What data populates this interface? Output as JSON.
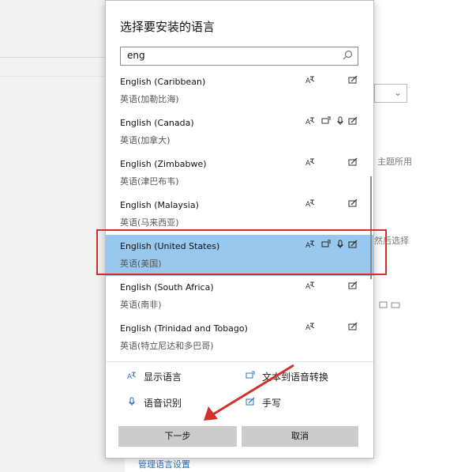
{
  "background": {
    "text_theme": "主题所用",
    "text_select": "然后选择",
    "link_manage": "管理语言设置"
  },
  "dialog": {
    "title": "选择要安装的语言",
    "search_value": "eng",
    "languages": [
      {
        "name": "English (Caribbean)",
        "native": "英语(加勒比海)",
        "features": [
          "text",
          "handwriting"
        ]
      },
      {
        "name": "English (Canada)",
        "native": "英语(加拿大)",
        "features": [
          "text",
          "speech",
          "mic",
          "handwriting"
        ]
      },
      {
        "name": "English (Zimbabwe)",
        "native": "英语(津巴布韦)",
        "features": [
          "text",
          "handwriting"
        ]
      },
      {
        "name": "English (Malaysia)",
        "native": "英语(马来西亚)",
        "features": [
          "text",
          "handwriting"
        ]
      },
      {
        "name": "English (United States)",
        "native": "英语(美国)",
        "features": [
          "text",
          "speech",
          "mic",
          "handwriting"
        ],
        "selected": true
      },
      {
        "name": "English (South Africa)",
        "native": "英语(南非)",
        "features": [
          "text",
          "handwriting"
        ]
      },
      {
        "name": "English (Trinidad and Tobago)",
        "native": "英语(特立尼达和多巴哥)",
        "features": [
          "text",
          "handwriting"
        ]
      }
    ],
    "legend": {
      "display_language": "显示语言",
      "text_to_speech": "文本到语音转换",
      "speech_recognition": "语音识别",
      "handwriting": "手写"
    },
    "buttons": {
      "next": "下一步",
      "cancel": "取消"
    }
  },
  "colors": {
    "selected": "#99c8ef",
    "highlight_box": "#d0312d",
    "button": "#cccccc",
    "link": "#2c6fbf"
  }
}
